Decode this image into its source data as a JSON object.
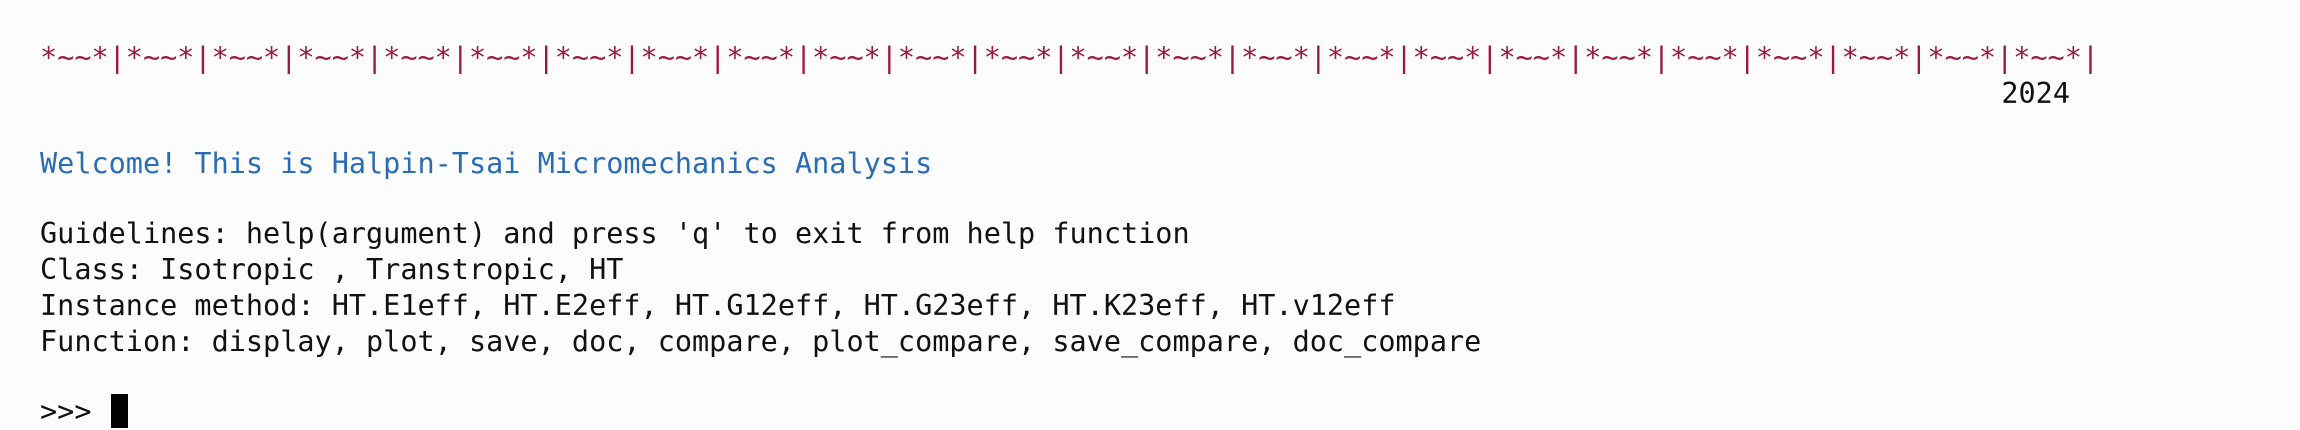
{
  "banner": {
    "text": "*~~*|*~~*|*~~*|*~~*|*~~*|*~~*|*~~*|*~~*|*~~*|*~~*|*~~*|*~~*|*~~*|*~~*|*~~*|*~~*|*~~*|*~~*|*~~*|*~~*|*~~*|*~~*|*~~*|*~~*|",
    "color": "#9b1b3f"
  },
  "year": "2024",
  "welcome": {
    "text": "Welcome! This is Halpin-Tsai Micromechanics Analysis",
    "color": "#2a6db4"
  },
  "guidelines": [
    "Guidelines: help(argument) and press 'q' to exit from help function",
    "Class: Isotropic , Transtropic, HT",
    "Instance method: HT.E1eff, HT.E2eff, HT.G12eff, HT.G23eff, HT.K23eff, HT.v12eff",
    "Function: display, plot, save, doc, compare, plot_compare, save_compare, doc_compare"
  ],
  "prompt": {
    "symbol": ">>> ",
    "cursor_color": "#000000"
  },
  "colors": {
    "background": "#fcfcfc",
    "text": "#111111"
  }
}
